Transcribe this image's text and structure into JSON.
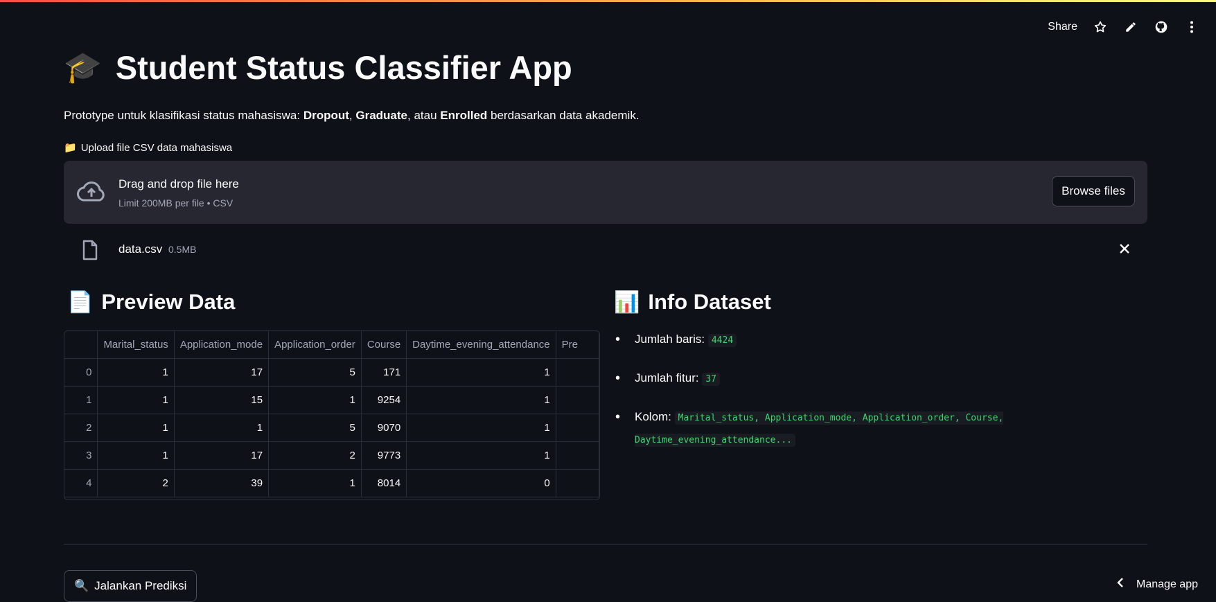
{
  "toolbar": {
    "share": "Share"
  },
  "title": {
    "emoji": "🎓",
    "text": "Student Status Classifier App"
  },
  "description": {
    "prefix": "Prototype untuk klasifikasi status mahasiswa: ",
    "b1": "Dropout",
    "sep1": ", ",
    "b2": "Graduate",
    "sep2": ", atau ",
    "b3": "Enrolled",
    "suffix": " berdasarkan data akademik."
  },
  "upload": {
    "label_emoji": "📁",
    "label": "Upload file CSV data mahasiswa",
    "drop_text": "Drag and drop file here",
    "limit_text": "Limit 200MB per file • CSV",
    "browse": "Browse files"
  },
  "file": {
    "name": "data.csv",
    "size": "0.5MB"
  },
  "preview": {
    "emoji": "📄",
    "title": "Preview Data"
  },
  "table": {
    "columns": [
      "Marital_status",
      "Application_mode",
      "Application_order",
      "Course",
      "Daytime_evening_attendance",
      "Pre"
    ],
    "rows": [
      [
        "0",
        "1",
        "17",
        "5",
        "171",
        "1"
      ],
      [
        "1",
        "1",
        "15",
        "1",
        "9254",
        "1"
      ],
      [
        "2",
        "1",
        "1",
        "5",
        "9070",
        "1"
      ],
      [
        "3",
        "1",
        "17",
        "2",
        "9773",
        "1"
      ],
      [
        "4",
        "2",
        "39",
        "1",
        "8014",
        "0"
      ]
    ]
  },
  "info": {
    "emoji": "📊",
    "title": "Info Dataset",
    "rows_label": "Jumlah baris:",
    "rows_value": "4424",
    "features_label": "Jumlah fitur:",
    "features_value": "37",
    "columns_label": "Kolom:",
    "columns_value": "Marital_status, Application_mode, Application_order, Course, Daytime_evening_attendance..."
  },
  "predict_button": {
    "emoji": "🔍",
    "label": "Jalankan Prediksi"
  },
  "manage": "Manage app"
}
